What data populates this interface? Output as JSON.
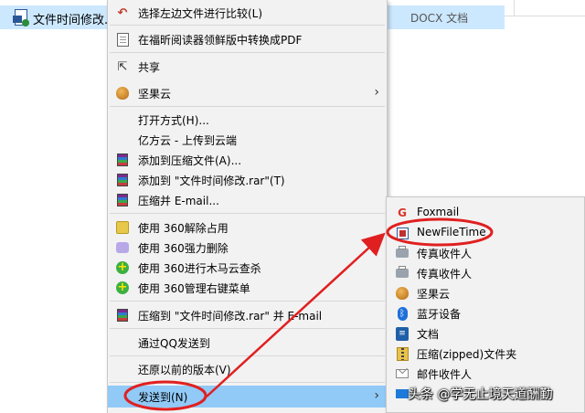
{
  "explorer": {
    "file_name": "文件时间修改.d",
    "file_type": "DOCX 文档"
  },
  "context_menu": {
    "items": [
      {
        "label": "选择左边文件进行比较(L)",
        "icon": "undo-arrow-icon"
      },
      {
        "label": "在福昕阅读器领鲜版中转换成PDF",
        "icon": "pdf-document-icon"
      },
      {
        "label": "共享",
        "icon": "share-icon"
      },
      {
        "label": "坚果云",
        "icon": "nutstore-icon",
        "submenu": true
      },
      {
        "label": "打开方式(H)..."
      },
      {
        "label": "亿方云 - 上传到云端"
      },
      {
        "label": "添加到压缩文件(A)...",
        "icon": "winrar-icon"
      },
      {
        "label": "添加到 \"文件时间修改.rar\"(T)",
        "icon": "winrar-icon"
      },
      {
        "label": "压缩并 E-mail...",
        "icon": "winrar-icon"
      },
      {
        "label": "使用 360解除占用",
        "icon": "360-unlock-icon"
      },
      {
        "label": "使用 360强力删除",
        "icon": "360-shred-icon"
      },
      {
        "label": "使用 360进行木马云查杀",
        "icon": "360-scan-icon"
      },
      {
        "label": "使用 360管理右键菜单",
        "icon": "360-scan-icon"
      },
      {
        "label": "压缩到 \"文件时间修改.rar\" 并 E-mail",
        "icon": "winrar-icon"
      },
      {
        "label": "通过QQ发送到"
      },
      {
        "label": "还原以前的版本(V)"
      },
      {
        "label": "发送到(N)",
        "submenu": true,
        "highlighted": true
      }
    ]
  },
  "send_to_menu": {
    "items": [
      {
        "label": "Foxmail",
        "icon": "foxmail-icon"
      },
      {
        "label": "NewFileTime",
        "icon": "newfiletime-icon"
      },
      {
        "label": "传真收件人",
        "icon": "fax-icon"
      },
      {
        "label": "传真收件人",
        "icon": "fax-icon"
      },
      {
        "label": "坚果云",
        "icon": "nutstore-icon"
      },
      {
        "label": "蓝牙设备",
        "icon": "bluetooth-icon"
      },
      {
        "label": "文档",
        "icon": "documents-icon"
      },
      {
        "label": "压缩(zipped)文件夹",
        "icon": "zip-folder-icon"
      },
      {
        "label": "邮件收件人",
        "icon": "mail-icon"
      },
      {
        "label": "",
        "icon": "desktop-icon"
      }
    ]
  },
  "watermark": "头条 @学无止境天道酬勤",
  "colors": {
    "menu_bg": "#f2f2f2",
    "hover": "#91c9f7",
    "selection": "#cce8ff",
    "annotation_red": "#e02020"
  }
}
